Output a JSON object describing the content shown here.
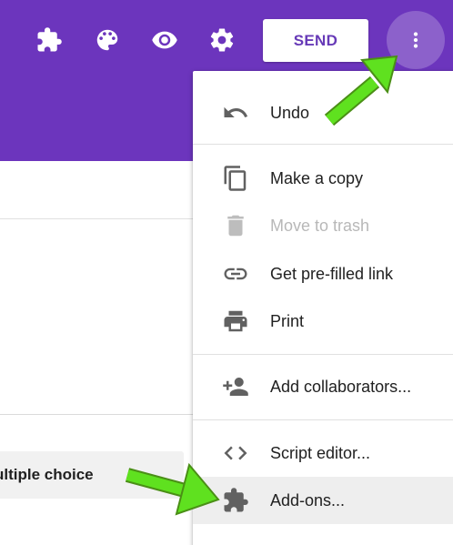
{
  "toolbar": {
    "icons": [
      "puzzle-icon",
      "palette-icon",
      "eye-icon",
      "gear-icon"
    ],
    "send_label": "SEND",
    "more_icon": "more-vert-icon"
  },
  "colors": {
    "header_bg": "#6c35bd",
    "send_text": "#673ab7",
    "arrow_green": "#5fe11f",
    "menu_icon": "#616161",
    "disabled_text": "#b8b8b8"
  },
  "menu": {
    "items": [
      {
        "icon": "undo-icon",
        "label": "Undo",
        "disabled": false
      },
      {
        "icon": "copy-icon",
        "label": "Make a copy",
        "disabled": false
      },
      {
        "icon": "trash-icon",
        "label": "Move to trash",
        "disabled": true
      },
      {
        "icon": "link-icon",
        "label": "Get pre-filled link",
        "disabled": false
      },
      {
        "icon": "print-icon",
        "label": "Print",
        "disabled": false
      },
      {
        "icon": "add-people-icon",
        "label": "Add collaborators...",
        "disabled": false
      },
      {
        "icon": "code-icon",
        "label": "Script editor...",
        "disabled": false
      },
      {
        "icon": "puzzle-icon",
        "label": "Add-ons...",
        "disabled": false,
        "highlighted": true
      }
    ]
  },
  "question": {
    "type_label": "ultiple choice"
  }
}
